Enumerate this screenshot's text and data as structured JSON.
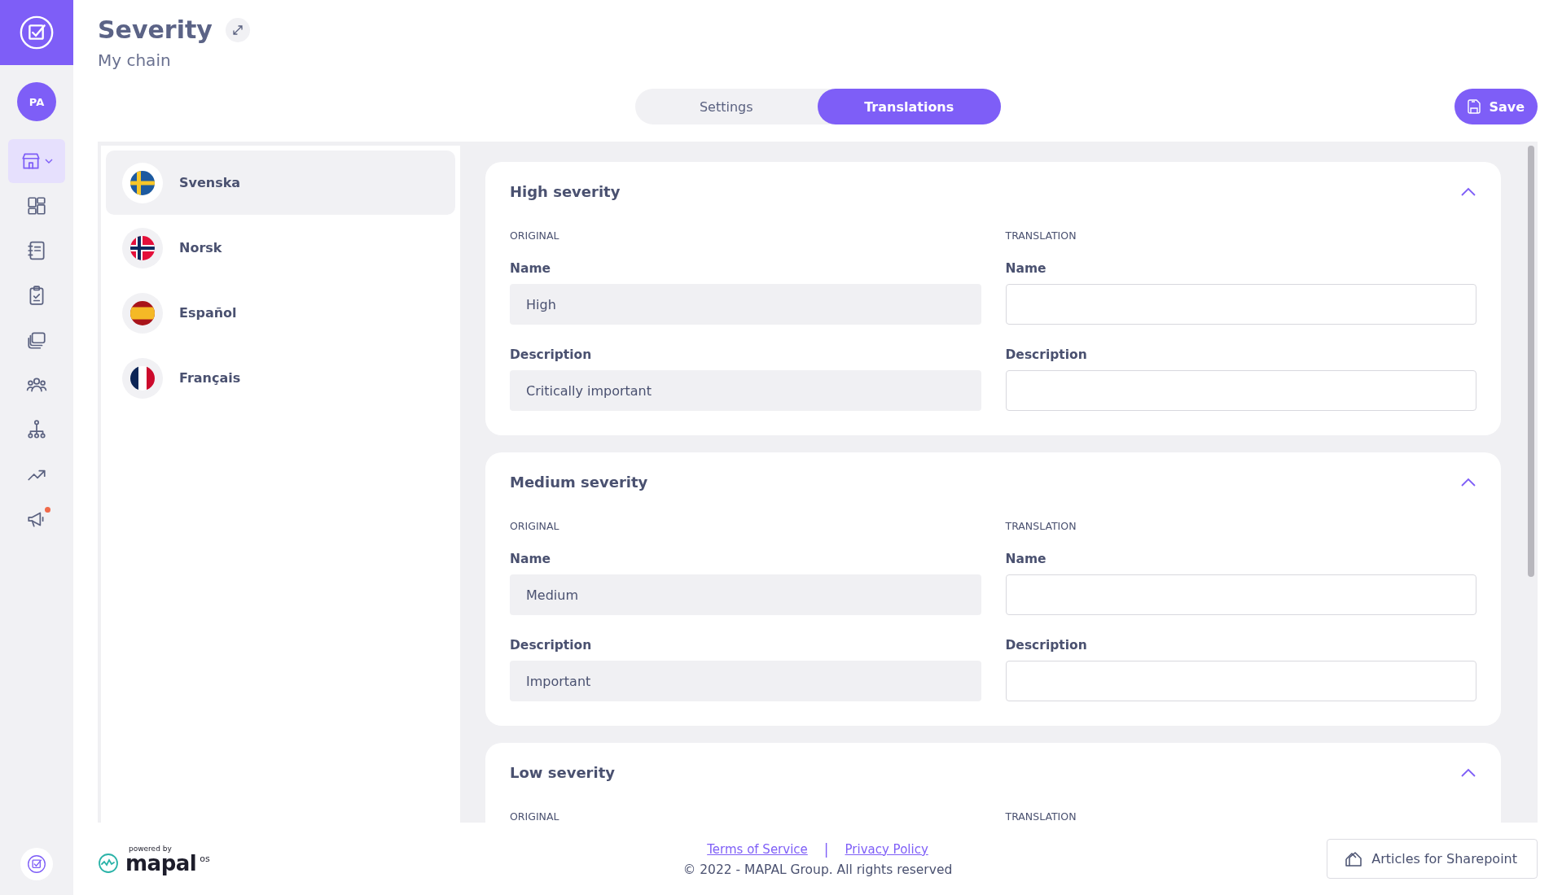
{
  "rail": {
    "avatar": "PA",
    "items": [
      {
        "kind": "store",
        "selected": true,
        "dropdown": true,
        "badge": false
      },
      {
        "kind": "dashboard",
        "selected": false,
        "dropdown": false,
        "badge": false
      },
      {
        "kind": "notebook",
        "selected": false,
        "dropdown": false,
        "badge": false
      },
      {
        "kind": "clipboard",
        "selected": false,
        "dropdown": false,
        "badge": false
      },
      {
        "kind": "layers",
        "selected": false,
        "dropdown": false,
        "badge": false
      },
      {
        "kind": "people",
        "selected": false,
        "dropdown": false,
        "badge": false
      },
      {
        "kind": "hierarchy",
        "selected": false,
        "dropdown": false,
        "badge": false
      },
      {
        "kind": "trend",
        "selected": false,
        "dropdown": false,
        "badge": false
      },
      {
        "kind": "megaphone",
        "selected": false,
        "dropdown": false,
        "badge": true
      }
    ]
  },
  "header": {
    "title": "Severity",
    "subtitle": "My chain"
  },
  "tabs": [
    {
      "label": "Settings",
      "selected": false
    },
    {
      "label": "Translations",
      "selected": true
    }
  ],
  "save_button": "Save",
  "languages": [
    {
      "label": "Svenska",
      "kind": "se",
      "selected": true
    },
    {
      "label": "Norsk",
      "kind": "no",
      "selected": false
    },
    {
      "label": "Español",
      "kind": "es",
      "selected": false
    },
    {
      "label": "Français",
      "kind": "fr",
      "selected": false
    }
  ],
  "sections": [
    {
      "title": "High severity",
      "expanded": true,
      "original_heading": "ORIGINAL",
      "translation_heading": "TRANSLATION",
      "fields": [
        {
          "original_label": "Name",
          "value": "High",
          "translation_label": "Name"
        },
        {
          "original_label": "Description",
          "value": "Critically important",
          "translation_label": "Description"
        }
      ]
    },
    {
      "title": "Medium severity",
      "expanded": true,
      "original_heading": "ORIGINAL",
      "translation_heading": "TRANSLATION",
      "fields": [
        {
          "original_label": "Name",
          "value": "Medium",
          "translation_label": "Name"
        },
        {
          "original_label": "Description",
          "value": "Important",
          "translation_label": "Description"
        }
      ]
    },
    {
      "title": "Low severity",
      "expanded": true,
      "original_heading": "ORIGINAL",
      "translation_heading": "TRANSLATION"
    }
  ],
  "footer": {
    "powered_by": "powered by",
    "brand": "mapal",
    "brand_suffix": "os",
    "links": [
      "Terms of Service",
      "Privacy Policy"
    ],
    "separator": "|",
    "copyright": "© 2022 - MAPAL Group. All rights reserved",
    "articles_button": "Articles for Sharepoint"
  }
}
